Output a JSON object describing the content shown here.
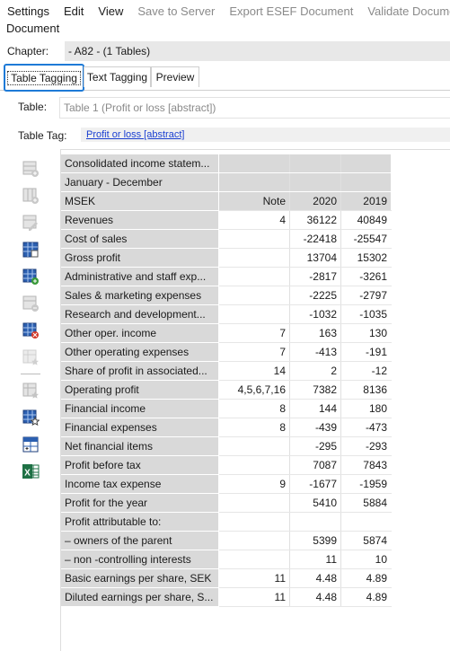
{
  "menu": [
    "Settings",
    "Edit",
    "View",
    "Save to Server",
    "Export ESEF Document",
    "Validate Document"
  ],
  "menu_disabled": [
    false,
    false,
    false,
    true,
    true,
    true
  ],
  "document_menu": "Document",
  "chapter": {
    "label": "Chapter:",
    "value": "- A82 - (1 Tables)"
  },
  "tabs": [
    "Table Tagging",
    "Text Tagging",
    "Preview"
  ],
  "table_field": {
    "label": "Table:",
    "placeholder": "Table 1 (Profit or loss [abstract])"
  },
  "table_tag": {
    "label": "Table Tag:",
    "link": "Profit or loss [abstract]"
  },
  "toolbar_icons": [
    "add-row-icon",
    "insert-row-icon",
    "edit-row-icon",
    "table-grid-icon",
    "add-column-icon",
    "remove-row-icon",
    "delete-icon",
    "tag-icon",
    "untag-icon",
    "table-settings-icon",
    "table-properties-icon",
    "excel-icon"
  ],
  "table_rows": [
    [
      "Consolidated income statem...",
      "",
      "",
      ""
    ],
    [
      "January - December",
      "",
      "",
      ""
    ],
    [
      "MSEK",
      "Note",
      "2020",
      "2019"
    ],
    [
      "Revenues",
      "4",
      "36122",
      "40849"
    ],
    [
      "Cost of sales",
      "",
      "-22418",
      "-25547"
    ],
    [
      "Gross profit",
      "",
      "13704",
      "15302"
    ],
    [
      "Administrative and staff exp...",
      "",
      "-2817",
      "-3261"
    ],
    [
      "Sales & marketing expenses",
      "",
      "-2225",
      "-2797"
    ],
    [
      "Research and development...",
      "",
      "-1032",
      "-1035"
    ],
    [
      "Other oper. income",
      "7",
      "163",
      "130"
    ],
    [
      "Other operating expenses",
      "7",
      "-413",
      "-191"
    ],
    [
      "Share of profit in associated...",
      "14",
      "2",
      "-12"
    ],
    [
      "Operating profit",
      "4,5,6,7,16",
      "7382",
      "8136"
    ],
    [
      "Financial income",
      "8",
      "144",
      "180"
    ],
    [
      "Financial expenses",
      "8",
      "-439",
      "-473"
    ],
    [
      "Net financial items",
      "",
      "-295",
      "-293"
    ],
    [
      "Profit before tax",
      "",
      "7087",
      "7843"
    ],
    [
      "Income tax expense",
      "9",
      "-1677",
      "-1959"
    ],
    [
      "Profit for the year",
      "",
      "5410",
      "5884"
    ],
    [
      "Profit attributable to:",
      "",
      "",
      ""
    ],
    [
      "– owners of the parent",
      "",
      "5399",
      "5874"
    ],
    [
      "– non -controlling interests",
      "",
      "11",
      "10"
    ],
    [
      "Basic earnings per share, SEK",
      "11",
      "4.48",
      "4.89"
    ],
    [
      "Diluted earnings per share, S...",
      "11",
      "4.48",
      "4.89"
    ]
  ]
}
